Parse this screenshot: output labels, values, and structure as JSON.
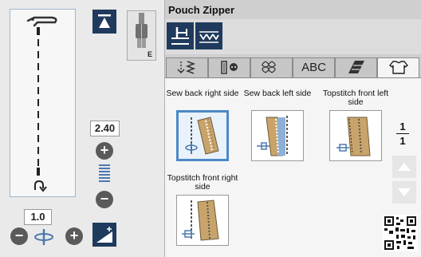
{
  "left_panel": {
    "foot_letter": "E",
    "stitch_width": "2.40",
    "stitch_length": "1.0"
  },
  "pattern": {
    "title": "Pouch Zipper"
  },
  "tabs": [
    {
      "label": "",
      "icon": "utility-stitch-icon"
    },
    {
      "label": "",
      "icon": "buttonhole-icon"
    },
    {
      "label": "",
      "icon": "decorative-stitch-icon"
    },
    {
      "label": "ABC",
      "icon": ""
    },
    {
      "label": "",
      "icon": "quilt-stitch-icon"
    },
    {
      "label": "",
      "icon": "shirt-icon"
    }
  ],
  "patterns": [
    {
      "label": "Sew back right side"
    },
    {
      "label": "Sew back left side"
    },
    {
      "label": "Topstitch front left side"
    },
    {
      "label": "Topstitch front right side"
    }
  ],
  "pagination": {
    "current": "1",
    "total": "1"
  },
  "colors": {
    "accent_dark": "#1f3a5c",
    "selected_border": "#4b88c7",
    "zipper_tan": "#c9a46a"
  }
}
